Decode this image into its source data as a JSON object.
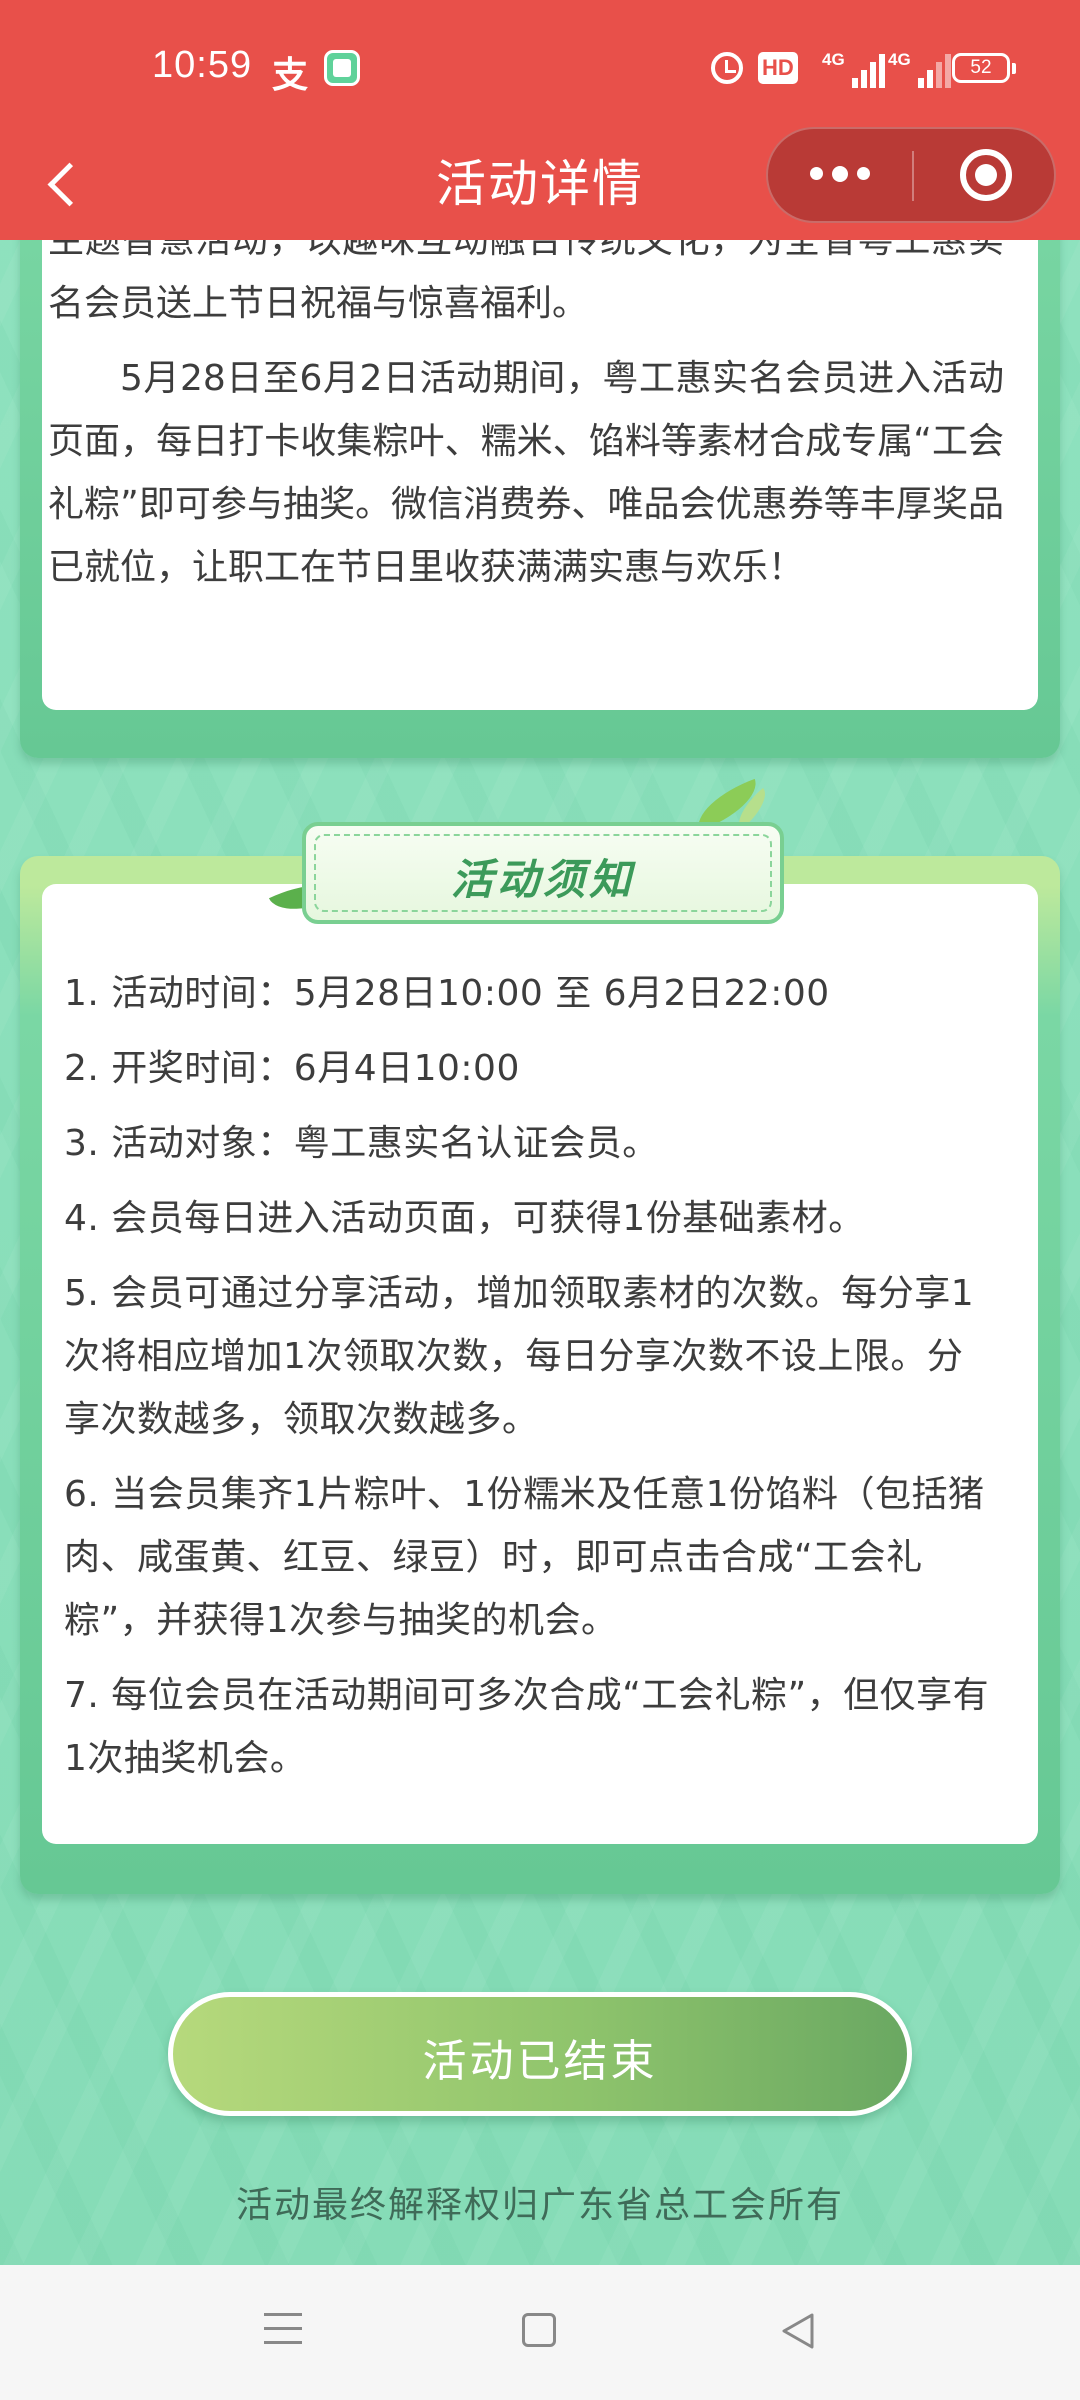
{
  "status_bar": {
    "time": "10:59",
    "battery": "52",
    "hd_badge": "HD",
    "signal_1": "4G",
    "signal_2": "4G",
    "icons": [
      "alipay-icon",
      "app-notification-icon",
      "alarm-icon",
      "hd-icon",
      "signal-icon",
      "signal-icon",
      "battery-icon"
    ]
  },
  "header": {
    "title": "活动详情",
    "back_icon": "chevron-left-icon",
    "more_icon": "more-dots-icon",
    "close_icon": "target-icon"
  },
  "intro": {
    "paragraph_1_cut": "主题智慧活动，以趣味互动融合传统文化，为全省粤工惠实名会员送上节日祝福与惊喜福利。",
    "paragraph_2": "5月28日至6月2日活动期间，粤工惠实名会员进入活动页面，每日打卡收集粽叶、糯米、馅料等素材合成专属“工会礼粽”即可参与抽奖。微信消费券、唯品会优惠券等丰厚奖品已就位，让职工在节日里收获满满实惠与欢乐！"
  },
  "notice": {
    "title": "活动须知",
    "rules": [
      "1. 活动时间：5月28日10:00 至 6月2日22:00",
      "2. 开奖时间：6月4日10:00",
      "3. 活动对象：粤工惠实名认证会员。",
      "4. 会员每日进入活动页面，可获得1份基础素材。",
      "5. 会员可通过分享活动，增加领取素材的次数。每分享1次将相应增加1次领取次数，每日分享次数不设上限。分享次数越多，领取次数越多。",
      "6. 当会员集齐1片粽叶、1份糯米及任意1份馅料（包括猪肉、咸蛋黄、红豆、绿豆）时，即可点击合成“工会礼粽”，并获得1次参与抽奖的机会。",
      "7. 每位会员在活动期间可多次合成“工会礼粽”，但仅享有1次抽奖机会。"
    ]
  },
  "action": {
    "ended_label": "活动已结束"
  },
  "footer": {
    "note": "活动最终解释权归广东省总工会所有"
  },
  "system_nav": {
    "icons": [
      "menu-icon",
      "home-icon",
      "back-triangle-icon"
    ]
  },
  "colors": {
    "header_red": "#e8504a",
    "page_green": "#8fe1bd",
    "card_frame_green": "#6fcf9b",
    "button_green": "#8fc46c",
    "title_green": "#3c9a5a"
  }
}
